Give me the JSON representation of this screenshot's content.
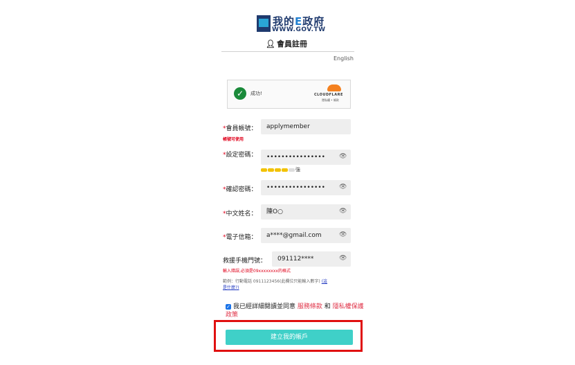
{
  "header": {
    "logo_title_a": "我的",
    "logo_title_e": "E",
    "logo_title_b": "政府",
    "logo_url": "WWW.GOV.TW",
    "page_title": "會員註冊",
    "language_link": "English"
  },
  "captcha": {
    "status": "成功!",
    "brand": "CLOUDFLARE",
    "footer": "隱私權 • 條款"
  },
  "form": {
    "account_label": "會員帳號：",
    "account_value": "applymember",
    "account_ok": "帳號可使用",
    "password_label": "設定密碼：",
    "password_value": "••••••••••••••••",
    "strength_label": "強",
    "strength_level": 4,
    "strength_max": 5,
    "confirm_label": "確認密碼：",
    "confirm_value": "••••••••••••••••",
    "name_label": "中文姓名：",
    "name_value": "陳O○",
    "email_label": "電子信箱：",
    "email_value": "a****@gmail.com",
    "rescue_label": "救援手機門號：",
    "rescue_value": "091112****",
    "rescue_error": "輸入錯誤,必須是09xxxxxxxx的格式",
    "hint_text": "範例：行動電話 0911123456(此欄位只能輸入數字)",
    "hint_link_a": "(這",
    "hint_link_b": "是什麼?)",
    "required_mark": "*"
  },
  "agreement": {
    "text": "我已經詳細閱讀並同意",
    "terms": "服務條款",
    "and": "和",
    "privacy": "隱私權保護政策"
  },
  "submit_label": "建立我的帳戶",
  "colors": {
    "accent": "#3fd0c8",
    "error": "#e0001a",
    "highlight": "#e01010"
  }
}
